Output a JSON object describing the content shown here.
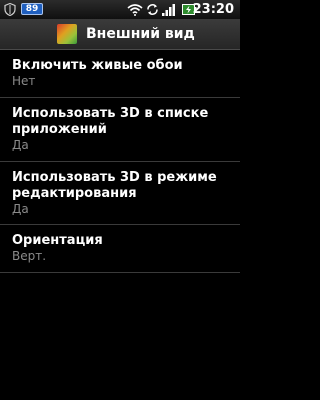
{
  "status_bar": {
    "icons": [
      "shield-icon",
      "notification-badge",
      "wifi-icon",
      "sync-icon",
      "signal-icon",
      "battery-charging-icon"
    ],
    "badge_text": "89",
    "time": "23:20"
  },
  "title_bar": {
    "icon": "wallpaper-icon",
    "title": "Внешний вид"
  },
  "settings": [
    {
      "title": "Включить живые обои",
      "summary": "Нет"
    },
    {
      "title": "Использовать 3D в списке приложений",
      "summary": "Да"
    },
    {
      "title": "Использовать 3D в режиме редактирования",
      "summary": "Да"
    },
    {
      "title": "Ориентация",
      "summary": "Верт."
    }
  ],
  "colors": {
    "background": "#000000",
    "summary_text": "#8a8a8a",
    "divider": "#3a3a3a",
    "badge": "#1f5fbf"
  }
}
